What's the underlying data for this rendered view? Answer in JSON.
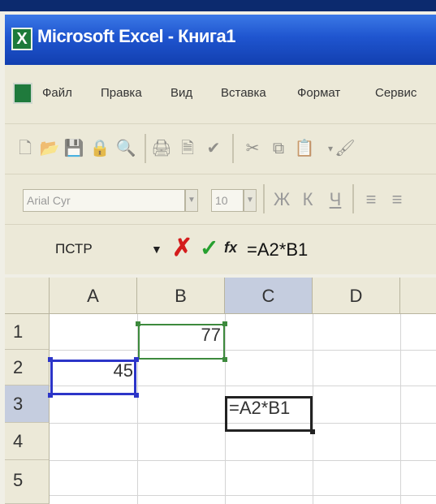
{
  "window": {
    "title": "Microsoft Excel - Книга1"
  },
  "menu": {
    "items": [
      {
        "label": "Файл"
      },
      {
        "label": "Правка"
      },
      {
        "label": "Вид"
      },
      {
        "label": "Вставка"
      },
      {
        "label": "Формат"
      },
      {
        "label": "Сервис"
      }
    ]
  },
  "standard_toolbar": {
    "icons": [
      "new-icon",
      "open-icon",
      "save-icon",
      "permission-icon",
      "search-icon",
      "print-icon",
      "print-preview-icon",
      "spelling-icon",
      "cut-icon",
      "copy-icon",
      "paste-icon",
      "format-painter-icon"
    ]
  },
  "formatting_toolbar": {
    "font_name": "Arial Cyr",
    "font_size": "10",
    "bold_label": "Ж",
    "italic_label": "К",
    "underline_label": "Ч",
    "align_left_label": "≡",
    "align_center_label": "≡"
  },
  "formula_bar": {
    "name_box": "ПСТР",
    "cancel_label": "✗",
    "enter_label": "✓",
    "fx_label": "fx",
    "formula": "=A2*B1"
  },
  "sheet": {
    "columns": [
      "A",
      "B",
      "C",
      "D"
    ],
    "rows": [
      "1",
      "2",
      "3",
      "4",
      "5"
    ],
    "active_column": "C",
    "active_row": "3",
    "cells": {
      "B1": "77",
      "A2": "45",
      "C3": "=A2*B1"
    }
  },
  "colors": {
    "title_bar": "#1f55cf",
    "cancel": "#d41c1c",
    "enter": "#27a02f",
    "ref_a2_border": "#2c35c8",
    "ref_b1_border": "#3d8a3d"
  }
}
